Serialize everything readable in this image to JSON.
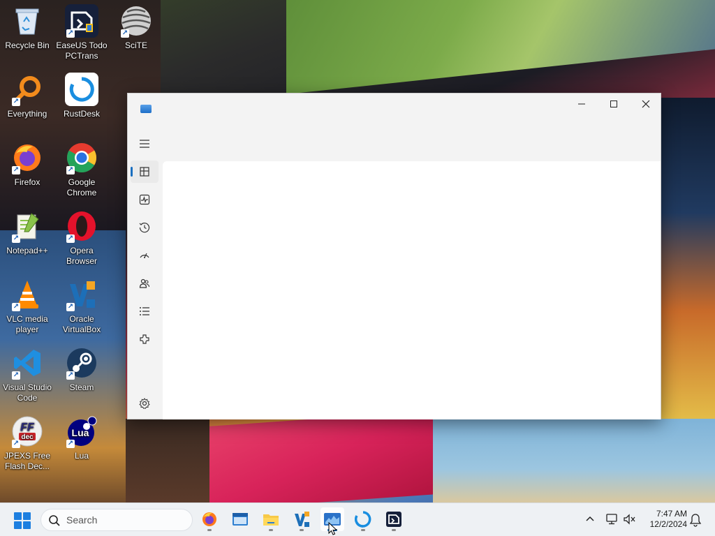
{
  "desktop": {
    "icons": [
      {
        "label": "Recycle Bin",
        "icon": "recycle-bin-icon"
      },
      {
        "label": "EaseUS Todo PCTrans",
        "icon": "easeus-icon"
      },
      {
        "label": "SciTE",
        "icon": "scite-icon"
      },
      {
        "label": "Everything",
        "icon": "everything-icon"
      },
      {
        "label": "RustDesk",
        "icon": "rustdesk-icon"
      },
      {
        "label": "Firefox",
        "icon": "firefox-icon"
      },
      {
        "label": "Google Chrome",
        "icon": "chrome-icon"
      },
      {
        "label": "Notepad++",
        "icon": "notepadpp-icon"
      },
      {
        "label": "Opera Browser",
        "icon": "opera-icon"
      },
      {
        "label": "VLC media player",
        "icon": "vlc-icon"
      },
      {
        "label": "Oracle VirtualBox",
        "icon": "virtualbox-icon"
      },
      {
        "label": "Visual Studio Code",
        "icon": "vscode-icon"
      },
      {
        "label": "Steam",
        "icon": "steam-icon"
      },
      {
        "label": "JPEXS Free Flash Dec...",
        "icon": "jpexs-icon"
      },
      {
        "label": "Lua",
        "icon": "lua-icon"
      }
    ]
  },
  "window": {
    "nav": {
      "items": [
        {
          "name": "processes",
          "icon": "processes-icon",
          "active": true
        },
        {
          "name": "performance",
          "icon": "performance-icon",
          "active": false
        },
        {
          "name": "app-history",
          "icon": "history-icon",
          "active": false
        },
        {
          "name": "startup-apps",
          "icon": "startup-icon",
          "active": false
        },
        {
          "name": "users",
          "icon": "users-icon",
          "active": false
        },
        {
          "name": "details",
          "icon": "details-icon",
          "active": false
        },
        {
          "name": "services",
          "icon": "services-icon",
          "active": false
        }
      ],
      "settings_icon": "settings-icon"
    }
  },
  "taskbar": {
    "search_placeholder": "Search",
    "apps": [
      {
        "icon": "firefox-icon",
        "running": true
      },
      {
        "icon": "windows-terminal-icon",
        "running": false
      },
      {
        "icon": "file-explorer-icon",
        "running": true
      },
      {
        "icon": "virtualbox-icon",
        "running": true
      },
      {
        "icon": "task-manager-icon",
        "running": true,
        "active": true
      },
      {
        "icon": "rustdesk-icon",
        "running": true
      },
      {
        "icon": "easeus-icon",
        "running": true
      }
    ],
    "clock": {
      "time": "7:47 AM",
      "date": "12/2/2024"
    }
  },
  "colors": {
    "accent": "#1a6fc0",
    "taskbar_bg": "#eef1f4",
    "window_bg": "#f3f3f3"
  }
}
